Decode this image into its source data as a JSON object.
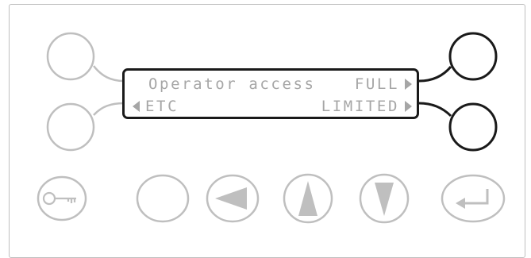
{
  "display": {
    "row1_left": "Operator access",
    "row1_right": "FULL",
    "row2_left": "ETC",
    "row2_right": "LIMITED"
  },
  "soft_keys": [
    "top-left",
    "bottom-left",
    "top-right",
    "bottom-right"
  ],
  "keypad": [
    "key-icon",
    "blank",
    "left-arrow-icon",
    "up-arrow-icon",
    "down-arrow-icon",
    "enter-icon"
  ],
  "colors": {
    "active": "#1a1a1a",
    "inactive": "#bfbfbf",
    "lcd_text": "#a6a6a6"
  }
}
